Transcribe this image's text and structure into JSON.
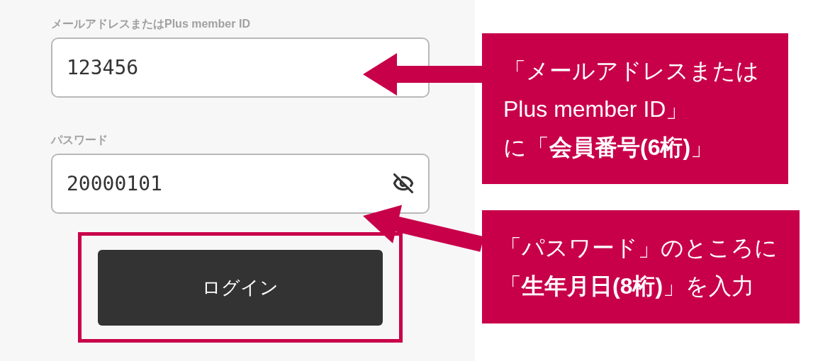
{
  "form": {
    "fields": [
      {
        "kind": "text",
        "label": "メールアドレスまたはPlus member ID",
        "value": "123456"
      },
      {
        "kind": "password",
        "label": "パスワード",
        "value": "20000101"
      }
    ],
    "login_button": {
      "label": "ログイン",
      "highlighted": true
    }
  },
  "callouts": [
    {
      "lines": [
        "「メールアドレスまたは",
        "Plus member ID」",
        "に「**会員番号(6桁)**」"
      ]
    },
    {
      "lines": [
        "「パスワード」のところに",
        "「**生年月日(8桁)**」を入力"
      ]
    }
  ]
}
